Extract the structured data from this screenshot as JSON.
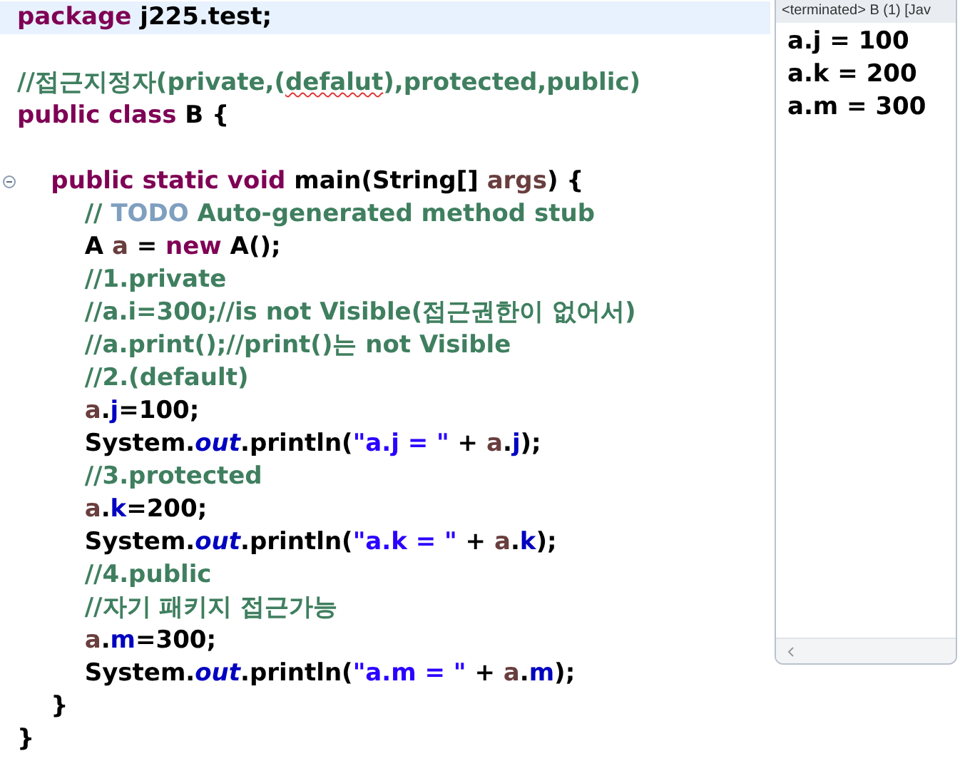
{
  "editor": {
    "lines": [
      {
        "current": true,
        "fold": false,
        "tokens": [
          {
            "kind": "kw",
            "text": "package "
          },
          {
            "kind": "plain",
            "text": "j225.test;"
          }
        ]
      },
      {
        "current": false,
        "fold": false
      },
      {
        "current": false,
        "fold": false,
        "tokens": [
          {
            "kind": "comment",
            "text": "//접근지정자(private,("
          },
          {
            "kind": "misspelled",
            "text": "defalut"
          },
          {
            "kind": "comment",
            "text": "),protected,public)"
          }
        ]
      },
      {
        "current": false,
        "fold": false,
        "tokens": [
          {
            "kind": "kw",
            "text": "public class "
          },
          {
            "kind": "plain",
            "text": "B {"
          }
        ]
      },
      {
        "current": false,
        "fold": false
      },
      {
        "current": false,
        "fold": true,
        "tokens": [
          {
            "kind": "kw",
            "text": "    public static void "
          },
          {
            "kind": "plain",
            "text": "main(String[] "
          },
          {
            "kind": "local",
            "text": "args"
          },
          {
            "kind": "plain",
            "text": ") {"
          }
        ]
      },
      {
        "current": false,
        "fold": false,
        "tokens": [
          {
            "kind": "comment",
            "text": "        // "
          },
          {
            "kind": "todo",
            "text": "TODO"
          },
          {
            "kind": "comment",
            "text": " Auto-generated method stub"
          }
        ]
      },
      {
        "current": false,
        "fold": false,
        "tokens": [
          {
            "kind": "plain",
            "text": "        A "
          },
          {
            "kind": "local",
            "text": "a"
          },
          {
            "kind": "plain",
            "text": " = "
          },
          {
            "kind": "kw",
            "text": "new "
          },
          {
            "kind": "plain",
            "text": "A();"
          }
        ]
      },
      {
        "current": false,
        "fold": false,
        "tokens": [
          {
            "kind": "comment",
            "text": "        //1.private"
          }
        ]
      },
      {
        "current": false,
        "fold": false,
        "tokens": [
          {
            "kind": "comment",
            "text": "        //a.i=300;//is not Visible(접근권한이 없어서)"
          }
        ]
      },
      {
        "current": false,
        "fold": false,
        "tokens": [
          {
            "kind": "comment",
            "text": "        //a.print();//print()는 not Visible"
          }
        ]
      },
      {
        "current": false,
        "fold": false,
        "tokens": [
          {
            "kind": "comment",
            "text": "        //2.(default)"
          }
        ]
      },
      {
        "current": false,
        "fold": false,
        "tokens": [
          {
            "kind": "local",
            "text": "        a"
          },
          {
            "kind": "plain",
            "text": "."
          },
          {
            "kind": "field",
            "text": "j"
          },
          {
            "kind": "plain",
            "text": "=100;"
          }
        ]
      },
      {
        "current": false,
        "fold": false,
        "tokens": [
          {
            "kind": "plain",
            "text": "        System."
          },
          {
            "kind": "static",
            "text": "out"
          },
          {
            "kind": "plain",
            "text": ".println("
          },
          {
            "kind": "string",
            "text": "\"a.j = \""
          },
          {
            "kind": "plain",
            "text": " + "
          },
          {
            "kind": "local",
            "text": "a"
          },
          {
            "kind": "plain",
            "text": "."
          },
          {
            "kind": "field",
            "text": "j"
          },
          {
            "kind": "plain",
            "text": ");"
          }
        ]
      },
      {
        "current": false,
        "fold": false,
        "tokens": [
          {
            "kind": "comment",
            "text": "        //3.protected"
          }
        ]
      },
      {
        "current": false,
        "fold": false,
        "tokens": [
          {
            "kind": "local",
            "text": "        a"
          },
          {
            "kind": "plain",
            "text": "."
          },
          {
            "kind": "field",
            "text": "k"
          },
          {
            "kind": "plain",
            "text": "=200;"
          }
        ]
      },
      {
        "current": false,
        "fold": false,
        "tokens": [
          {
            "kind": "plain",
            "text": "        System."
          },
          {
            "kind": "static",
            "text": "out"
          },
          {
            "kind": "plain",
            "text": ".println("
          },
          {
            "kind": "string",
            "text": "\"a.k = \""
          },
          {
            "kind": "plain",
            "text": " + "
          },
          {
            "kind": "local",
            "text": "a"
          },
          {
            "kind": "plain",
            "text": "."
          },
          {
            "kind": "field",
            "text": "k"
          },
          {
            "kind": "plain",
            "text": ");"
          }
        ]
      },
      {
        "current": false,
        "fold": false,
        "tokens": [
          {
            "kind": "comment",
            "text": "        //4.public"
          }
        ]
      },
      {
        "current": false,
        "fold": false,
        "tokens": [
          {
            "kind": "comment",
            "text": "        //자기 패키지 접근가능"
          }
        ]
      },
      {
        "current": false,
        "fold": false,
        "tokens": [
          {
            "kind": "local",
            "text": "        a"
          },
          {
            "kind": "plain",
            "text": "."
          },
          {
            "kind": "field",
            "text": "m"
          },
          {
            "kind": "plain",
            "text": "=300;"
          }
        ]
      },
      {
        "current": false,
        "fold": false,
        "tokens": [
          {
            "kind": "plain",
            "text": "        System."
          },
          {
            "kind": "static",
            "text": "out"
          },
          {
            "kind": "plain",
            "text": ".println("
          },
          {
            "kind": "string",
            "text": "\"a.m = \""
          },
          {
            "kind": "plain",
            "text": " + "
          },
          {
            "kind": "local",
            "text": "a"
          },
          {
            "kind": "plain",
            "text": "."
          },
          {
            "kind": "field",
            "text": "m"
          },
          {
            "kind": "plain",
            "text": ");"
          }
        ]
      },
      {
        "current": false,
        "fold": false,
        "tokens": [
          {
            "kind": "plain",
            "text": "    }"
          }
        ]
      },
      {
        "current": false,
        "fold": false,
        "tokens": [
          {
            "kind": "plain",
            "text": "}"
          }
        ]
      }
    ]
  },
  "console": {
    "header": "<terminated> B (1) [Jav",
    "output": [
      "a.j = 100",
      "a.k = 200",
      "a.m = 300"
    ]
  }
}
